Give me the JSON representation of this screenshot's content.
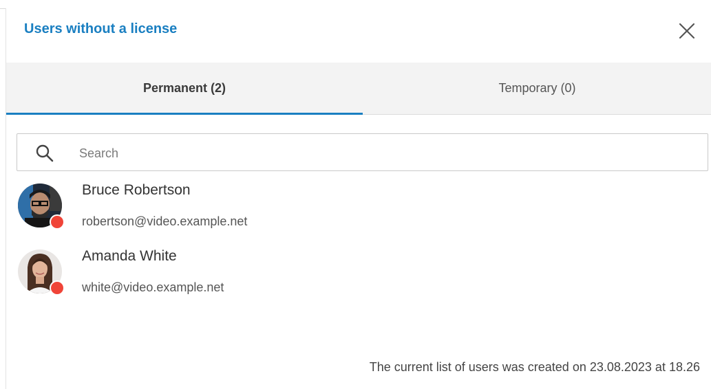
{
  "dialog": {
    "title": "Users without a license",
    "close_icon": "close-icon"
  },
  "tabs": [
    {
      "label": "Permanent (2)",
      "active": true
    },
    {
      "label": "Temporary (0)",
      "active": false
    }
  ],
  "search": {
    "placeholder": "Search",
    "value": "",
    "icon": "search-icon"
  },
  "users": [
    {
      "name": "Bruce Robertson",
      "email": "robertson@video.example.net",
      "status": "offline"
    },
    {
      "name": "Amanda White",
      "email": "white@video.example.net",
      "status": "offline"
    }
  ],
  "footer": {
    "text": "The current list of users was created on 23.08.2023 at 18.26"
  },
  "colors": {
    "accent": "#1a7fc1",
    "status_offline": "#f04438",
    "tab_bar_bg": "#f3f3f3"
  }
}
